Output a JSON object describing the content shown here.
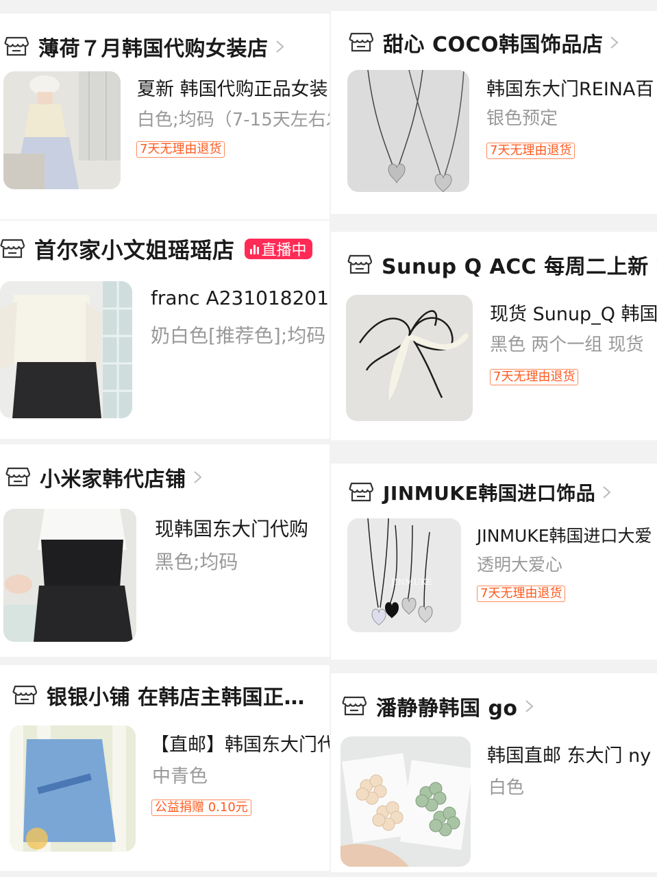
{
  "left": [
    {
      "shop": "薄荷７月韩国代购女装店",
      "title": "夏新 韩国代购正品女装",
      "spec": "白色;均码（7-15天左右发",
      "tag": "7天无理由退货"
    },
    {
      "shop": "首尔家小文姐瑶瑶店",
      "live": "直播中",
      "title": "franc A231018201",
      "spec": "奶白色[推荐色];均码",
      "tag": ""
    },
    {
      "shop": "小米家韩代店铺",
      "title": "现韩国东大门代购",
      "spec": "黑色;均码",
      "tag": ""
    },
    {
      "shop": "银银小铺 在韩店主韩国正…",
      "title": "【直邮】韩国东大门代",
      "spec": "中青色",
      "tag": "公益捐赠 0.10元"
    }
  ],
  "right": [
    {
      "shop": "甜心 COCO韩国饰品店",
      "title": "韩国东大门REINA百",
      "spec": "银色预定",
      "tag": "7天无理由退货"
    },
    {
      "shop": "Sunup Q ACC 每周二上新",
      "title": "现货 Sunup_Q 韩国",
      "spec": "黑色 两个一组 现货",
      "tag": "7天无理由退货"
    },
    {
      "shop": "JINMUKE韩国进口饰品",
      "title": "JINMUKE韩国进口大爱",
      "spec": "透明大爱心",
      "tag": "7天无理由退货",
      "watermark": "JINMUKE"
    },
    {
      "shop": "潘静静韩国 go",
      "title": "韩国直邮 东大门 ny",
      "spec": "白色",
      "tag": ""
    }
  ],
  "colors": {
    "background": "#f2f2f2",
    "card": "#ffffff",
    "tag_orange": "#ff5a1f",
    "live_red": "#ff2a55",
    "spec_gray": "#999999"
  },
  "icons": [
    "store-icon",
    "chevron-right-icon",
    "live-bars-icon"
  ]
}
